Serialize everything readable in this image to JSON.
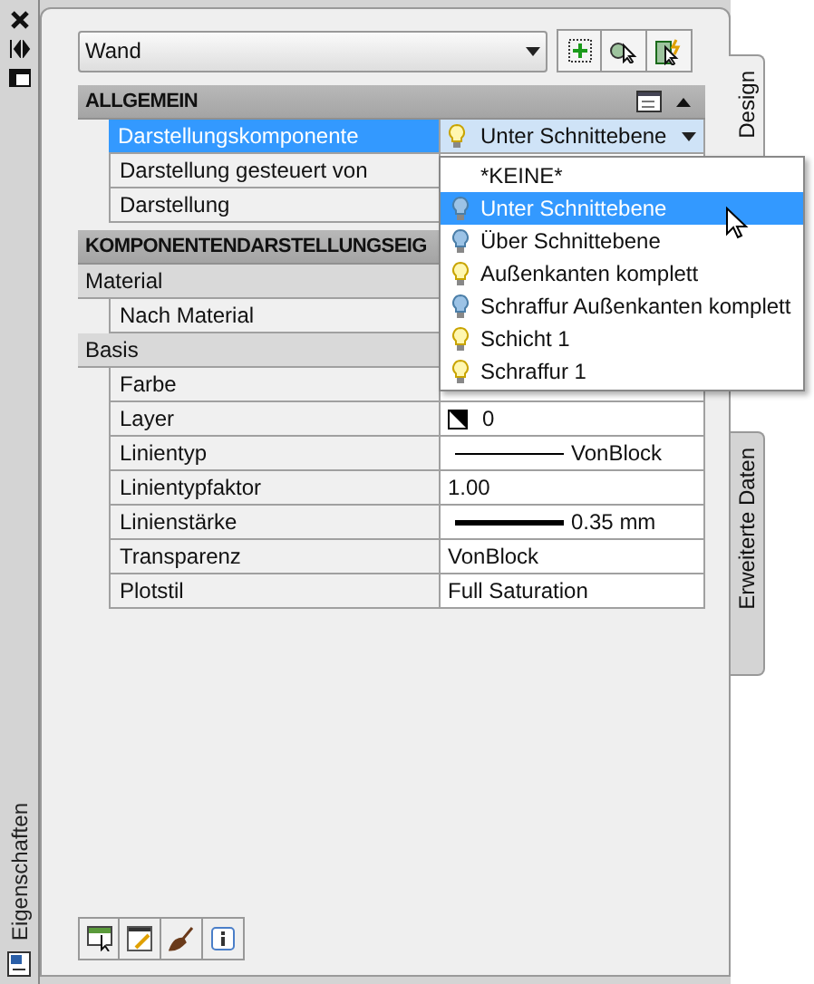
{
  "side_strip": {
    "label": "Eigenschaften"
  },
  "object_selector": {
    "value": "Wand"
  },
  "sections": [
    {
      "title": "ALLGEMEIN",
      "expanded": true,
      "rows": [
        {
          "kind": "property",
          "label": "Darstellungskomponente",
          "selected": true,
          "value": {
            "kind": "lamp",
            "text": "Unter Schnittebene",
            "on": true
          }
        },
        {
          "kind": "property",
          "label": "Darstellung gesteuert von",
          "selected": false
        },
        {
          "kind": "property",
          "label": "Darstellung",
          "selected": false
        }
      ]
    },
    {
      "title": "KOMPONENTENDARSTELLUNGSEIG",
      "expanded": true,
      "rows": [
        {
          "kind": "group",
          "label": "Material"
        },
        {
          "kind": "property",
          "label": "Nach Material",
          "selected": false
        },
        {
          "kind": "group",
          "label": "Basis"
        },
        {
          "kind": "property",
          "label": "Farbe",
          "selected": false
        },
        {
          "kind": "property",
          "label": "Layer",
          "selected": false,
          "value": {
            "kind": "layer",
            "text": "0"
          }
        },
        {
          "kind": "property",
          "label": "Linientyp",
          "selected": false,
          "value": {
            "kind": "line",
            "text": "VonBlock"
          }
        },
        {
          "kind": "property",
          "label": "Linientypfaktor",
          "selected": false,
          "value": {
            "kind": "text",
            "text": "1.00"
          }
        },
        {
          "kind": "property",
          "label": "Linienstärke",
          "selected": false,
          "value": {
            "kind": "lineweight",
            "text": "0.35 mm"
          }
        },
        {
          "kind": "property",
          "label": "Transparenz",
          "selected": false,
          "value": {
            "kind": "text",
            "text": "VonBlock"
          }
        },
        {
          "kind": "property",
          "label": "Plotstil",
          "selected": false,
          "value": {
            "kind": "text",
            "text": "Full Saturation"
          }
        }
      ]
    }
  ],
  "dropdown": {
    "items": [
      {
        "kind": "plain",
        "label": "*KEINE*",
        "selected": false
      },
      {
        "kind": "lamp",
        "label": "Unter Schnittebene",
        "on": false,
        "selected": true
      },
      {
        "kind": "lamp",
        "label": "Über Schnittebene",
        "on": false,
        "selected": false
      },
      {
        "kind": "lamp",
        "label": "Außenkanten komplett",
        "on": true,
        "selected": false
      },
      {
        "kind": "lamp",
        "label": "Schraffur Außenkanten komplett",
        "on": false,
        "selected": false
      },
      {
        "kind": "lamp",
        "label": "Schicht 1",
        "on": true,
        "selected": false
      },
      {
        "kind": "lamp",
        "label": "Schraffur 1",
        "on": true,
        "selected": false
      }
    ]
  },
  "side_tabs": [
    {
      "label": "Design",
      "selected": true
    },
    {
      "label": "Erweiterte Daten",
      "selected": false
    }
  ]
}
